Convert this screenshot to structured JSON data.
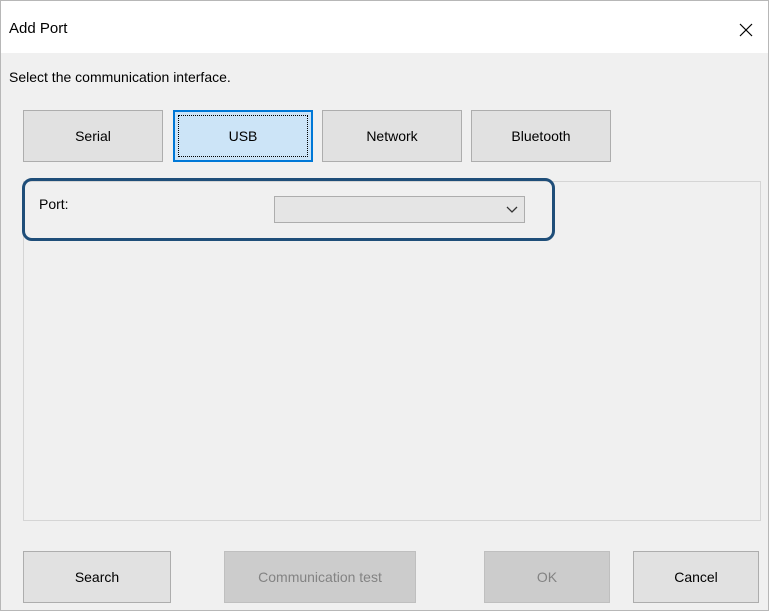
{
  "window": {
    "title": "Add Port",
    "close_icon": "close-icon"
  },
  "instruction": "Select the communication interface.",
  "interfaces": [
    {
      "label": "Serial",
      "selected": false
    },
    {
      "label": "USB",
      "selected": true
    },
    {
      "label": "Network",
      "selected": false
    },
    {
      "label": "Bluetooth",
      "selected": false
    }
  ],
  "port": {
    "label": "Port:",
    "value": "",
    "dropdown_icon": "chevron-down-icon"
  },
  "footer": {
    "search_label": "Search",
    "comm_test_label": "Communication test",
    "ok_label": "OK",
    "cancel_label": "Cancel"
  },
  "colors": {
    "selected_fill": "#cce4f7",
    "selected_border": "#0078d7",
    "highlight_border": "#1f4e79"
  }
}
